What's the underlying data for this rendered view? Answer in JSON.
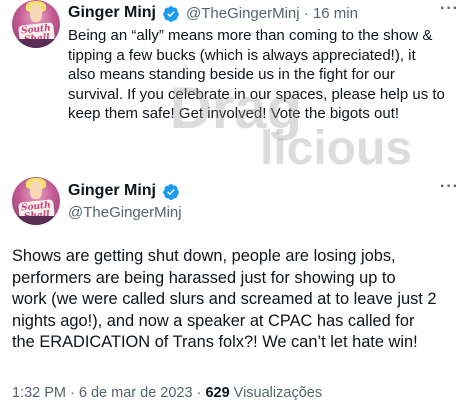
{
  "tweet1": {
    "display_name": "Ginger Minj",
    "handle": "@TheGingerMinj",
    "separator": "·",
    "time_ago": "16 min",
    "more_label": "···",
    "avatar_sign": "South Shall Rise",
    "body_lines": [
      "Being an “ally” means more than coming to the show &",
      "tipping a few bucks (which is always appreciated!), it",
      "also means standing beside us in the fight for our",
      "survival. If you celebrate in our spaces, please help us to",
      "keep them safe! Get involved! Vote the bigots out!"
    ]
  },
  "watermark": {
    "word_top": "Drag",
    "word_bottom": "licious"
  },
  "tweet2": {
    "display_name": "Ginger Minj",
    "handle": "@TheGingerMinj",
    "more_label": "···",
    "avatar_sign": "South Shall Rise",
    "body_lines": [
      "Shows are getting shut down, people are losing jobs,",
      "performers are being harassed just for showing up to",
      "work (we were called slurs and screamed at to leave just 2",
      "nights ago!), and now a speaker at CPAC has called for",
      "the ERADICATION of Trans folx?! We can’t let hate win!"
    ],
    "timestamp": "1:32 PM · 6 de mar de 2023 · ",
    "views_count": "629",
    "views_label": "Visualizações"
  },
  "colors": {
    "verified": "#1d9bf0",
    "muted": "#536471",
    "text": "#0f1419"
  }
}
